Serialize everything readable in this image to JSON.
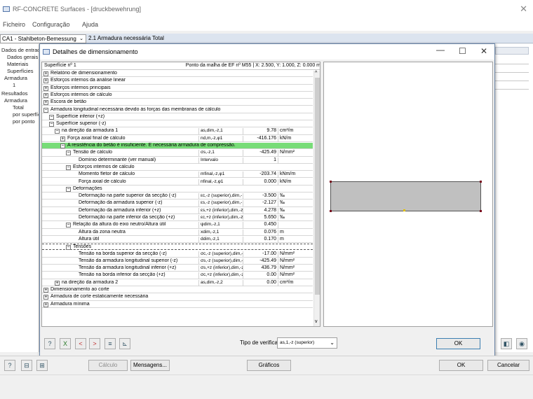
{
  "window": {
    "title": "RF-CONCRETE Surfaces - [druckbewehrung]",
    "close": "✕"
  },
  "menu": {
    "items": [
      "Ficheiro",
      "Configuração",
      "Ajuda"
    ]
  },
  "toolbar": {
    "case": "CA1 - Stahlbeton-Bemessung",
    "table": "2.1 Armadura necessária Total"
  },
  "navtree": {
    "items": [
      "Dados de entrada",
      "Dados gerais",
      "Materiais",
      "Superfícies",
      "Armadura",
      "1",
      "Resultados",
      "Armadura",
      "Total",
      "por superfície",
      "por ponto"
    ]
  },
  "dialog": {
    "title": "Detalhes de dimensionamento",
    "header_left": "Superfície nº 1",
    "header_right": "Ponto da malha de EF nº M55  |  X: 2.500, Y: 1.000, Z: 0.000 m",
    "rows": [
      {
        "label": "Relatório de dimensionamento",
        "sym": "",
        "val": "",
        "unit": ""
      },
      {
        "label": "Esforços internos da análise linear",
        "sym": "",
        "val": "",
        "unit": ""
      },
      {
        "label": "Esforços internos principais",
        "sym": "",
        "val": "",
        "unit": ""
      },
      {
        "label": "Esforços internos de cálculo",
        "sym": "",
        "val": "",
        "unit": ""
      },
      {
        "label": "Escora de betão",
        "sym": "",
        "val": "",
        "unit": ""
      },
      {
        "label": "Armadura longitudinal necessária devido às forças das membranas de cálculo",
        "sym": "",
        "val": "",
        "unit": ""
      },
      {
        "label": "Superfície inferior (+z)",
        "sym": "",
        "val": "",
        "unit": ""
      },
      {
        "label": "Superfície superior (-z)",
        "sym": "",
        "val": "",
        "unit": ""
      },
      {
        "label": "na direção da armadura 1",
        "sym": "as,dim,-z,1",
        "val": "9.78",
        "unit": "cm²/m"
      },
      {
        "label": "Força axial final de cálculo",
        "sym": "nd,m,-z,φ1",
        "val": "-416.176",
        "unit": "kN/m"
      },
      {
        "label": "A resistência do betão é insuficiente. É necessária armadura de compressão.",
        "sym": "",
        "val": "",
        "unit": ""
      },
      {
        "label": "Tensão de cálculo",
        "sym": "σs,-z,1",
        "val": "-425.49",
        "unit": "N/mm²"
      },
      {
        "label": "Domínio determinante (ver manual)",
        "sym": "Intervalo",
        "val": "1",
        "unit": ""
      },
      {
        "label": "Esforços internos de cálculo",
        "sym": "",
        "val": "",
        "unit": ""
      },
      {
        "label": "Momento fletor de cálculo",
        "sym": "mfinal,-z,φ1",
        "val": "-203.74",
        "unit": "kNm/m"
      },
      {
        "label": "Força axial de cálculo",
        "sym": "nfinal,-z,φ1",
        "val": "0.000",
        "unit": "kN/m"
      },
      {
        "label": "Deformações",
        "sym": "",
        "val": "",
        "unit": ""
      },
      {
        "label": "Deformação na parte superior da secção (-z)",
        "sym": "εc,-z (superior),dim,-",
        "val": "-3.500",
        "unit": "‰"
      },
      {
        "label": "Deformação da armadura superior (-z)",
        "sym": "εs,-z (superior),dim,-",
        "val": "-2.127",
        "unit": "‰"
      },
      {
        "label": "Deformação da armadura inferior (+z)",
        "sym": "εs,+z (inferior),dim,-z",
        "val": "4.278",
        "unit": "‰"
      },
      {
        "label": "Deformação na parte inferior da secção (+z)",
        "sym": "εc,+z (inferior),dim,-z",
        "val": "5.650",
        "unit": "‰"
      },
      {
        "label": "Relação da altura do eixo neutro/Altura útil",
        "sym": "ψdim,-z,1",
        "val": "0.450",
        "unit": ""
      },
      {
        "label": "Altura da zona neutra",
        "sym": "xdim,-z,1",
        "val": "0.076",
        "unit": "m"
      },
      {
        "label": "Altura útil",
        "sym": "ddim,-z,1",
        "val": "0.170",
        "unit": "m"
      },
      {
        "label": "Tensões",
        "sym": "",
        "val": "",
        "unit": ""
      },
      {
        "label": "Tensão na borda superior da secção (-z)",
        "sym": "σc,-z (superior),dim,-",
        "val": "-17.00",
        "unit": "N/mm²"
      },
      {
        "label": "Tensão da armadura longitudinal superior (-z)",
        "sym": "σs,-z (superior),dim,-",
        "val": "-425.49",
        "unit": "N/mm²"
      },
      {
        "label": "Tensão da armadura longitudinal inferior (+z)",
        "sym": "σs,+z (inferior),dim,-z",
        "val": "436.79",
        "unit": "N/mm²"
      },
      {
        "label": "Tensão na borda inferior da secção (+z)",
        "sym": "σc,+z (inferior),dim,-z",
        "val": "0.00",
        "unit": "N/mm²"
      },
      {
        "label": "na direção da armadura 2",
        "sym": "as,dim,-z,2",
        "val": "0.00",
        "unit": "cm²/m"
      },
      {
        "label": "Dimensionamento ao corte",
        "sym": "",
        "val": "",
        "unit": ""
      },
      {
        "label": "Armadura de corte estaticamente necessária",
        "sym": "",
        "val": "",
        "unit": ""
      },
      {
        "label": "Armadura mínima",
        "sym": "",
        "val": "",
        "unit": ""
      }
    ],
    "check_type_label": "Tipo de verificação:",
    "check_type_value": "as,1,-z (superior)",
    "ok": "OK"
  },
  "bottom": {
    "calc": "Cálculo",
    "messages": "Mensagens...",
    "graphics": "Gráficos",
    "ok": "OK",
    "cancel": "Cancelar"
  },
  "colors": {
    "warning_row": "#78dc78",
    "section_fill": "#c0c0c0",
    "node": "#7a1020"
  }
}
